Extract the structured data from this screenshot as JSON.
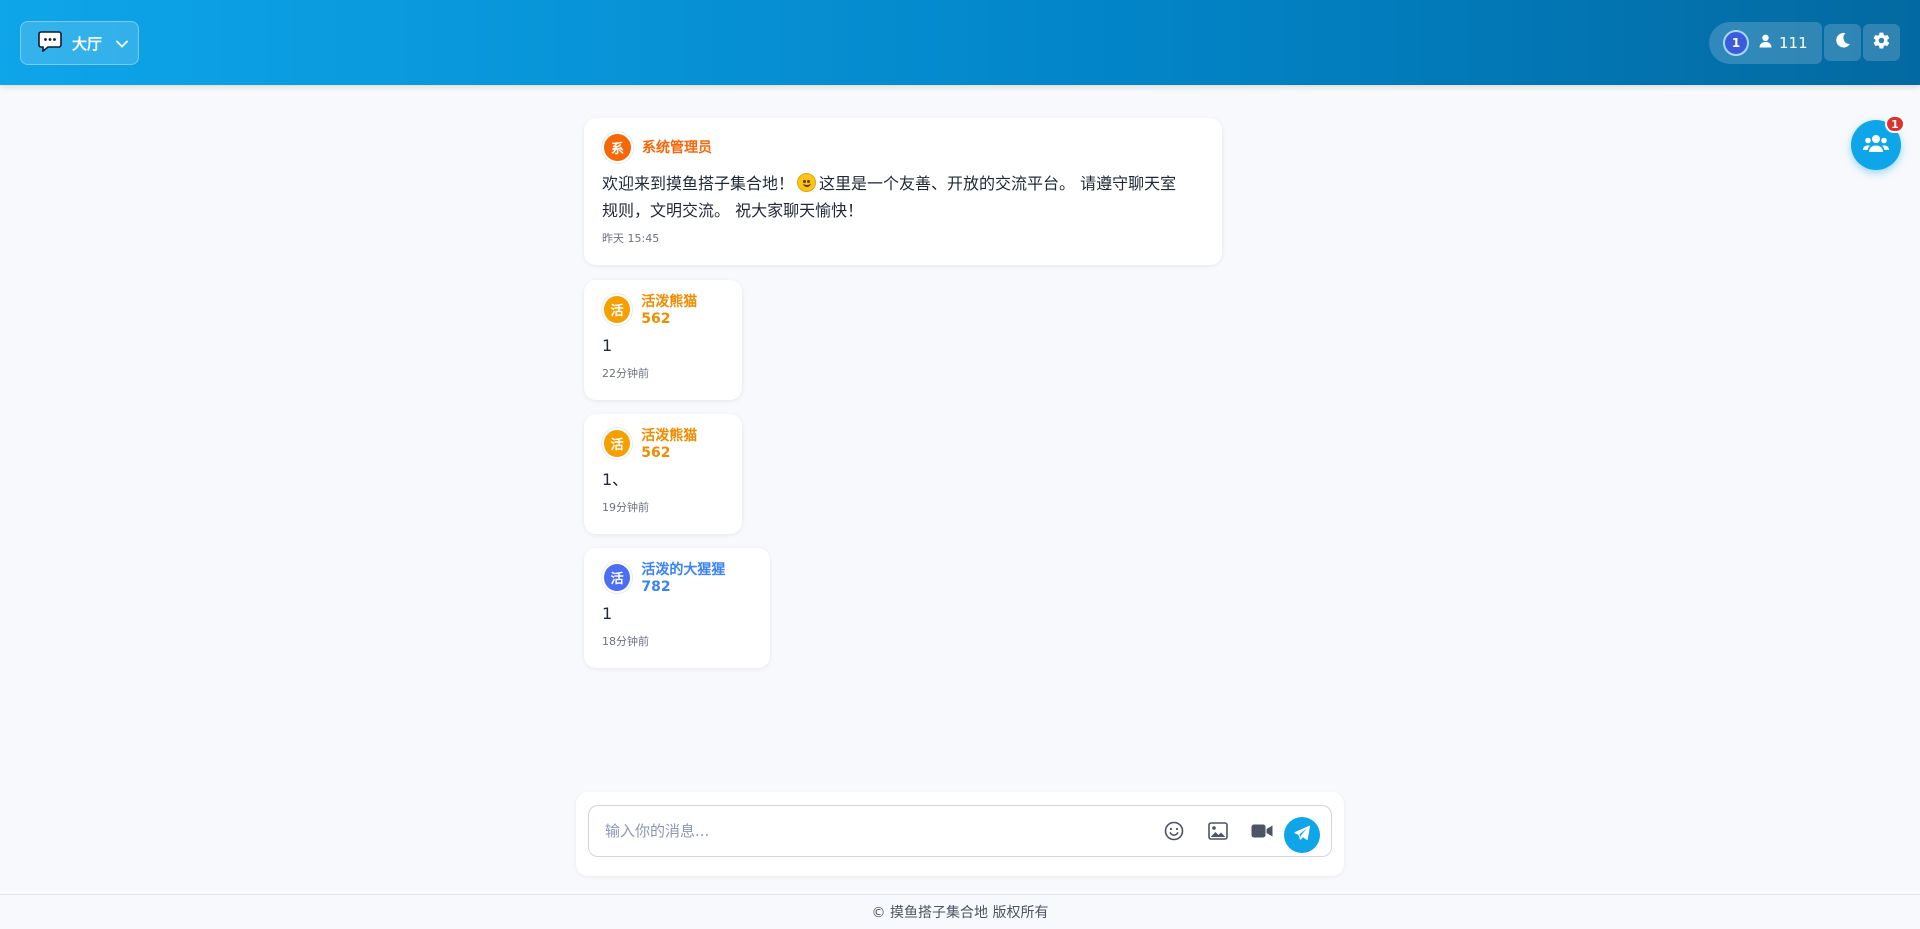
{
  "header": {
    "room_label": "大厅",
    "online_badge": "1",
    "user_count": "111"
  },
  "colors": {
    "header_start": "#0ea5e9",
    "header_end": "#0369a1",
    "accent": "#0ea5e9",
    "badge_red": "#e03131"
  },
  "messages": [
    {
      "avatar": "系",
      "avatar_color": "#f76707",
      "name": "系统管理员",
      "name_color": "#f76707",
      "text_line1_a": "欢迎来到摸鱼搭子集合地！",
      "text_line1_b": "这里是一个友善、开放的交流平台。 请遵守聊天室",
      "text_line2": "规则，文明交流。 祝大家聊天愉快！",
      "time": "昨天 15:45"
    },
    {
      "avatar": "活",
      "avatar_color": "#f59f00",
      "name": "活泼熊猫562",
      "name_color": "#f08c00",
      "text": "1",
      "time": "22分钟前"
    },
    {
      "avatar": "活",
      "avatar_color": "#f59f00",
      "name": "活泼熊猫562",
      "name_color": "#f08c00",
      "text": "1、",
      "time": "19分钟前"
    },
    {
      "avatar": "活",
      "avatar_color": "#4c6ef5",
      "name": "活泼的大猩猩782",
      "name_color": "#3b82f6",
      "text": "1",
      "time": "18分钟前"
    }
  ],
  "users_fab": {
    "badge": "1"
  },
  "composer": {
    "placeholder": "输入你的消息..."
  },
  "footer": {
    "text": "© 摸鱼搭子集合地 版权所有"
  }
}
